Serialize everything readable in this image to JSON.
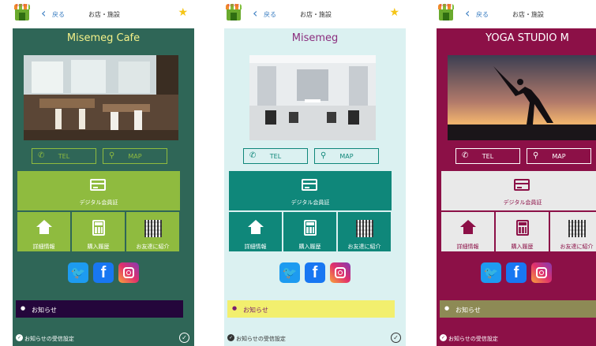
{
  "common": {
    "logo_text": "みせめぐ",
    "back_icon": "chevron-left-icon",
    "back_label": "戻る",
    "breadcrumb": "お店・施設",
    "favorite_icon": "star-icon",
    "favorite_color": "#f5c518",
    "tel_label": "TEL",
    "map_label": "MAP",
    "card_label": "デジタル会員証",
    "tiles": [
      "詳細情報",
      "購入履歴",
      "お友達に紹介"
    ],
    "social": [
      "twitter-icon",
      "facebook-icon",
      "instagram-icon"
    ],
    "twitter_glyph": "🐦",
    "facebook_glyph": "f",
    "news_label": "お知らせ",
    "notice_label": "お知らせの受信設定"
  },
  "screens": [
    {
      "id": "cafe",
      "title": "Misemeg Cafe",
      "theme": {
        "bg": "#2f6657",
        "title": "#f4f18a",
        "accent": "#8fbb3f",
        "card_bg": "#8fbb3f",
        "card_text": "#ffffff",
        "news_bg": "#24063b",
        "news_text": "#ffffff",
        "notice_text": "#ffffff"
      },
      "photo": "cafe-interior-photo"
    },
    {
      "id": "salon",
      "title": "Misemeg",
      "theme": {
        "bg": "#dbf1f1",
        "title": "#8b2e7e",
        "accent": "#0f877a",
        "card_bg": "#0f877a",
        "card_text": "#ffffff",
        "news_bg": "#f2ef6e",
        "news_text": "#7a1f6e",
        "notice_text": "#333333"
      },
      "photo": "salon-interior-photo"
    },
    {
      "id": "yoga",
      "title": "YOGA STUDIO M",
      "theme": {
        "bg": "#8c1047",
        "title": "#ffffff",
        "accent": "#ffffff",
        "card_bg": "#e9e9e9",
        "card_text": "#8c1047",
        "news_bg": "#8d8a55",
        "news_text": "#ffffff",
        "notice_text": "#ffffff"
      },
      "photo": "yoga-silhouette-photo"
    }
  ]
}
